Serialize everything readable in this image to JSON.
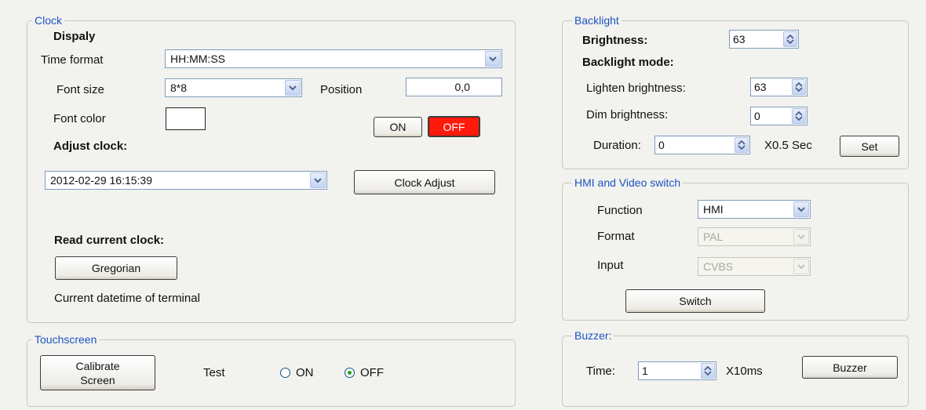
{
  "clock": {
    "legend": "Clock",
    "display_heading": "Dispaly",
    "time_format_label": "Time format",
    "time_format_value": "HH:MM:SS",
    "font_size_label": "Font size",
    "font_size_value": "8*8",
    "position_label": "Position",
    "position_value": "0,0",
    "font_color_label": "Font color",
    "font_color_swatch": "#ffffff",
    "on_label": "ON",
    "off_label": "OFF",
    "adjust_heading": "Adjust clock:",
    "datetime_value": "2012-02-29 16:15:39",
    "clock_adjust_label": "Clock Adjust",
    "read_heading": "Read current clock:",
    "gregorian_label": "Gregorian",
    "current_datetime_label": "Current datetime of terminal"
  },
  "touchscreen": {
    "legend": "Touchscreen",
    "calibrate_line1": "Calibrate",
    "calibrate_line2": "Screen",
    "test_label": "Test",
    "option_on": "ON",
    "option_off": "OFF",
    "selected": "OFF"
  },
  "backlight": {
    "legend": "Backlight",
    "brightness_label": "Brightness:",
    "brightness_value": "63",
    "mode_heading": "Backlight mode:",
    "lighten_label": "Lighten brightness:",
    "lighten_value": "63",
    "dim_label": "Dim brightness:",
    "dim_value": "0",
    "duration_label": "Duration:",
    "duration_value": "0",
    "duration_unit": "X0.5 Sec",
    "set_label": "Set"
  },
  "hmi": {
    "legend": "HMI and Video switch",
    "function_label": "Function",
    "function_value": "HMI",
    "format_label": "Format",
    "format_value": "PAL",
    "input_label": "Input",
    "input_value": "CVBS",
    "switch_label": "Switch"
  },
  "buzzer": {
    "legend": "Buzzer:",
    "time_label": "Time:",
    "time_value": "1",
    "time_unit": "X10ms",
    "buzzer_label": "Buzzer"
  },
  "colors": {
    "legend_blue": "#1b54c0",
    "off_red": "#ff1a0c",
    "panel_bg": "#f2f2ef"
  },
  "icons": [
    "chevron-down-icon",
    "spin-updown-icon",
    "radio-selected-icon"
  ]
}
